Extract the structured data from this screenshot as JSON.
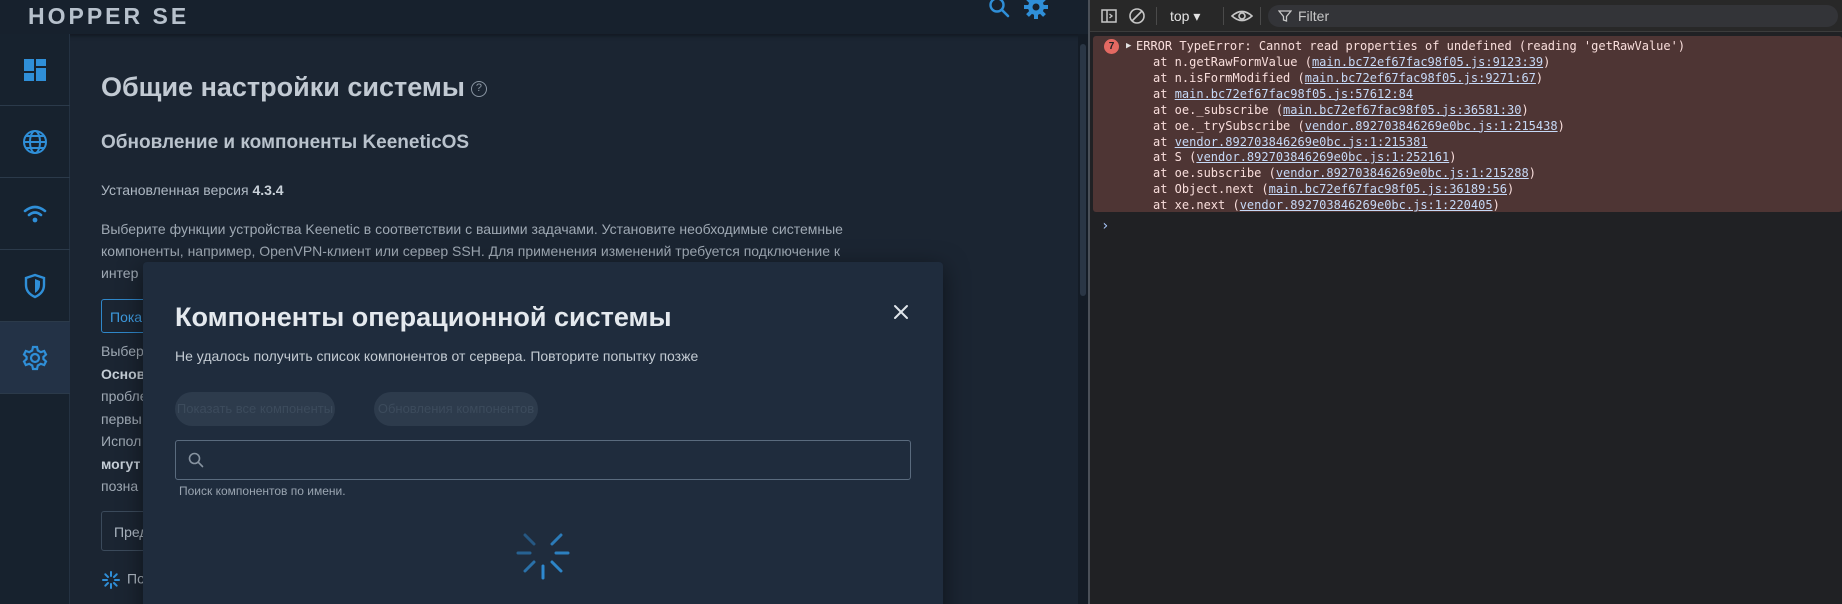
{
  "app": {
    "logo": "HOPPER SE",
    "page_title": "Общие настройки системы",
    "help_glyph": "?",
    "section_title": "Обновление и компоненты KeeneticOS",
    "version_label": "Установленная версия",
    "version_value": "4.3.4",
    "description_lines": [
      "Выберите функции устройства Keenetic в соответствии с вашими задачами. Установите необходимые системные",
      "компоненты, например, OpenVPN-клиент или сервер SSH. Для применения изменений требуется подключение к",
      "интер"
    ],
    "show_button_label": "Пока",
    "description2_lines": [
      "Выбер",
      "Основ",
      "пробле",
      "первы",
      "Испол",
      "могут",
      "позна"
    ],
    "preview_button_label": "Пред",
    "loading_label": "По"
  },
  "modal": {
    "title": "Компоненты операционной системы",
    "error": "Не удалось получить список компонентов от сервера. Повторите попытку позже",
    "pills": [
      "Показать все компоненты",
      "Обновления компонентов"
    ],
    "search_value": "",
    "search_hint": "Поиск компонентов по имени."
  },
  "devtools": {
    "context": "top ▾",
    "filter_placeholder": "Filter",
    "error_count": "7",
    "error_message": "ERROR TypeError: Cannot read properties of undefined (reading 'getRawValue')",
    "trace": [
      {
        "prefix": "at n.getRawFormValue (",
        "link": "main.bc72ef67fac98f05.js:9123:39",
        "suffix": ")"
      },
      {
        "prefix": "at n.isFormModified (",
        "link": "main.bc72ef67fac98f05.js:9271:67",
        "suffix": ")"
      },
      {
        "prefix": "at ",
        "link": "main.bc72ef67fac98f05.js:57612:84",
        "suffix": ""
      },
      {
        "prefix": "at oe._subscribe (",
        "link": "main.bc72ef67fac98f05.js:36581:30",
        "suffix": ")"
      },
      {
        "prefix": "at oe._trySubscribe (",
        "link": "vendor.892703846269e0bc.js:1:215438",
        "suffix": ")"
      },
      {
        "prefix": "at ",
        "link": "vendor.892703846269e0bc.js:1:215381",
        "suffix": ""
      },
      {
        "prefix": "at S (",
        "link": "vendor.892703846269e0bc.js:1:252161",
        "suffix": ")"
      },
      {
        "prefix": "at oe.subscribe (",
        "link": "vendor.892703846269e0bc.js:1:215288",
        "suffix": ")"
      },
      {
        "prefix": "at Object.next (",
        "link": "main.bc72ef67fac98f05.js:36189:56",
        "suffix": ")"
      },
      {
        "prefix": "at xe.next (",
        "link": "vendor.892703846269e0bc.js:1:220405",
        "suffix": ")"
      }
    ],
    "prompt": "›"
  },
  "colors": {
    "accent": "#2f87c9",
    "error_bg": "#4e3534",
    "error_badge": "#e46962",
    "link": "#c6d9f7"
  },
  "icons": {
    "sidebar": [
      "dashboard-icon",
      "globe-icon",
      "wifi-icon",
      "shield-icon",
      "gear-icon"
    ],
    "topbar": [
      "search-icon",
      "gear-icon"
    ]
  }
}
